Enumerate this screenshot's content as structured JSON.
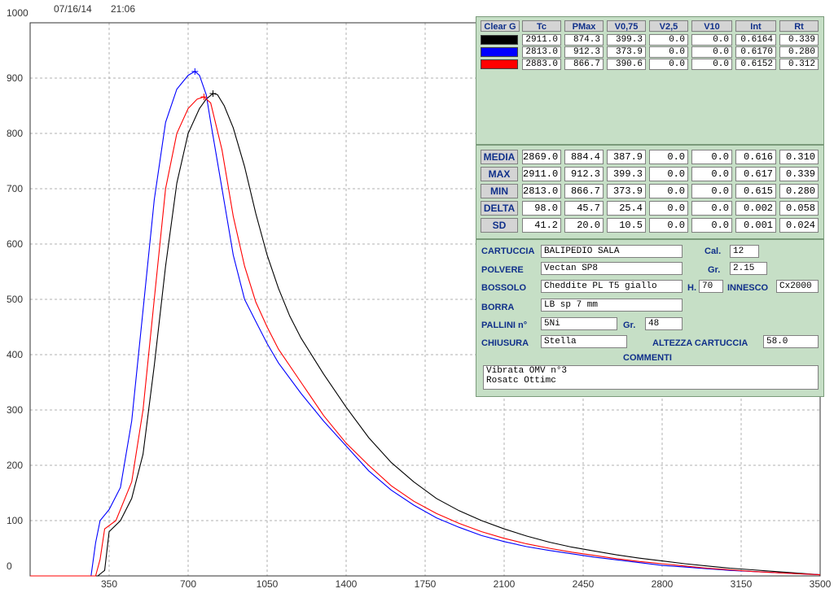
{
  "header": {
    "date": "07/16/14",
    "time": "21:06"
  },
  "chart_data": {
    "type": "line",
    "xlim": [
      0,
      3500
    ],
    "ylim": [
      0,
      1000
    ],
    "xticks": [
      350,
      700,
      1050,
      1400,
      1750,
      2100,
      2450,
      2800,
      3150,
      3500
    ],
    "yticks": [
      0,
      100,
      200,
      300,
      400,
      500,
      600,
      700,
      800,
      900,
      1000
    ],
    "grid": true,
    "series": [
      {
        "color": "#000000",
        "x": [
          0,
          300,
          330,
          350,
          400,
          450,
          500,
          550,
          600,
          650,
          700,
          750,
          780,
          810,
          830,
          860,
          900,
          950,
          1000,
          1050,
          1100,
          1150,
          1200,
          1300,
          1400,
          1500,
          1600,
          1700,
          1800,
          1900,
          2000,
          2100,
          2200,
          2300,
          2400,
          2500,
          2600,
          2700,
          2800,
          2900,
          3000,
          3100,
          3200,
          3300,
          3400,
          3500
        ],
        "y": [
          0,
          0,
          10,
          80,
          100,
          140,
          220,
          380,
          560,
          710,
          800,
          845,
          862,
          872,
          870,
          850,
          810,
          740,
          655,
          580,
          520,
          470,
          430,
          365,
          305,
          250,
          205,
          170,
          140,
          118,
          100,
          85,
          72,
          61,
          52,
          45,
          38,
          32,
          27,
          22,
          18,
          14,
          11,
          8,
          5,
          2
        ]
      },
      {
        "color": "#0000ff",
        "x": [
          0,
          270,
          290,
          310,
          350,
          400,
          450,
          500,
          550,
          600,
          650,
          700,
          730,
          750,
          780,
          800,
          850,
          900,
          950,
          1000,
          1050,
          1100,
          1200,
          1300,
          1400,
          1500,
          1600,
          1700,
          1800,
          1900,
          2000,
          2100,
          2200,
          2300,
          2400,
          2500,
          2600,
          2700,
          2800,
          2900,
          3000,
          3100,
          3200,
          3300,
          3400,
          3500
        ],
        "y": [
          0,
          0,
          60,
          100,
          120,
          160,
          280,
          480,
          680,
          820,
          880,
          905,
          912,
          905,
          870,
          820,
          700,
          580,
          500,
          460,
          420,
          385,
          330,
          280,
          235,
          190,
          155,
          128,
          105,
          88,
          73,
          62,
          53,
          46,
          40,
          34,
          29,
          24,
          19,
          16,
          13,
          10,
          8,
          6,
          4,
          2
        ]
      },
      {
        "color": "#ff0000",
        "x": [
          0,
          290,
          310,
          330,
          380,
          450,
          500,
          550,
          600,
          650,
          700,
          740,
          770,
          800,
          850,
          900,
          950,
          1000,
          1050,
          1100,
          1200,
          1300,
          1400,
          1500,
          1600,
          1700,
          1800,
          1900,
          2000,
          2100,
          2200,
          2300,
          2400,
          2500,
          2600,
          2700,
          2800,
          2900,
          3000,
          3100,
          3200,
          3300,
          3400,
          3500
        ],
        "y": [
          0,
          0,
          30,
          85,
          100,
          170,
          300,
          500,
          700,
          800,
          845,
          862,
          866,
          855,
          770,
          650,
          560,
          495,
          450,
          410,
          350,
          290,
          240,
          200,
          163,
          135,
          113,
          95,
          80,
          68,
          58,
          50,
          43,
          37,
          31,
          26,
          22,
          18,
          14,
          11,
          8,
          6,
          4,
          2
        ]
      }
    ]
  },
  "panel": {
    "headers": [
      "Clear G",
      "Tc",
      "PMax",
      "V0,75",
      "V2,5",
      "V10",
      "Int",
      "Rt"
    ],
    "rows": [
      {
        "color": "#000000",
        "values": [
          "2911.0",
          "874.3",
          "399.3",
          "0.0",
          "0.0",
          "0.6164",
          "0.339"
        ]
      },
      {
        "color": "#0000ff",
        "values": [
          "2813.0",
          "912.3",
          "373.9",
          "0.0",
          "0.0",
          "0.6170",
          "0.280"
        ]
      },
      {
        "color": "#ff0000",
        "values": [
          "2883.0",
          "866.7",
          "390.6",
          "0.0",
          "0.0",
          "0.6152",
          "0.312"
        ]
      }
    ],
    "stats": [
      {
        "label": "MEDIA",
        "values": [
          "2869.0",
          "884.4",
          "387.9",
          "0.0",
          "0.0",
          "0.616",
          "0.310"
        ]
      },
      {
        "label": "MAX",
        "values": [
          "2911.0",
          "912.3",
          "399.3",
          "0.0",
          "0.0",
          "0.617",
          "0.339"
        ]
      },
      {
        "label": "MIN",
        "values": [
          "2813.0",
          "866.7",
          "373.9",
          "0.0",
          "0.0",
          "0.615",
          "0.280"
        ]
      },
      {
        "label": "DELTA",
        "values": [
          "98.0",
          "45.7",
          "25.4",
          "0.0",
          "0.0",
          "0.002",
          "0.058"
        ]
      },
      {
        "label": "SD",
        "values": [
          "41.2",
          "20.0",
          "10.5",
          "0.0",
          "0.0",
          "0.001",
          "0.024"
        ]
      }
    ],
    "fields": {
      "cartuccia_label": "CARTUCCIA",
      "cartuccia": "BALIPEDIO  SALA",
      "cal_label": "Cal.",
      "cal": "12",
      "polvere_label": "POLVERE",
      "polvere": "Vectan SP8",
      "gr_label": "Gr.",
      "gr": "2.15",
      "bossolo_label": "BOSSOLO",
      "bossolo": "Cheddite PL T5 giallo",
      "h_label": "H.",
      "h": "70",
      "innesco_label": "INNESCO",
      "innesco": "Cx2000",
      "borra_label": "BORRA",
      "borra": "LB sp 7 mm",
      "pallini_label": "PALLINI n°",
      "pallini": "5Ni",
      "gr2_label": "Gr.",
      "gr2": "48",
      "chiusura_label": "CHIUSURA",
      "chiusura": "Stella",
      "altezza_label": "ALTEZZA CARTUCCIA",
      "altezza": "58.0",
      "commenti_label": "COMMENTI",
      "commenti_line1": "Vibrata  OMV n°3",
      "commenti_line2": "Rosatc Ottimc"
    }
  }
}
